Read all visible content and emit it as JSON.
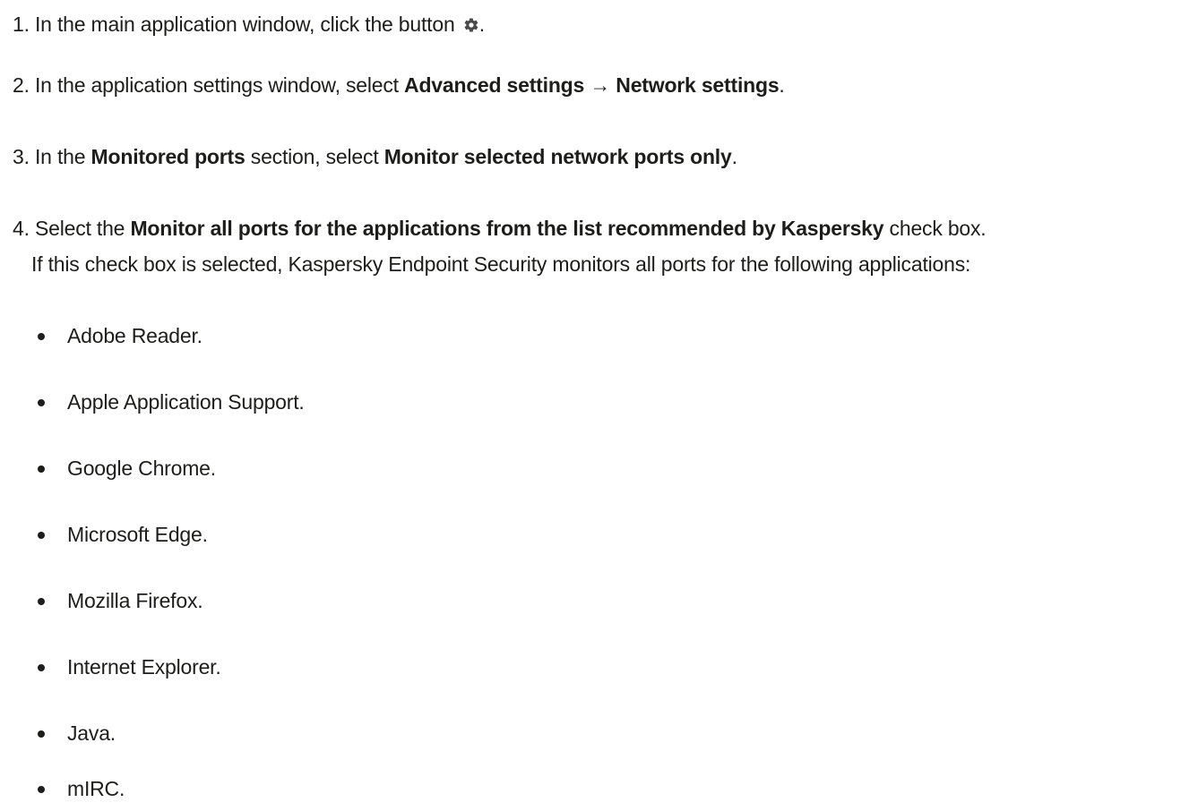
{
  "steps": [
    {
      "number": "1.",
      "parts": [
        {
          "text": " In the main application window, click the button ",
          "bold": false
        },
        {
          "icon": "gear-icon"
        },
        {
          "text": ".",
          "bold": false
        }
      ]
    },
    {
      "number": "2.",
      "parts": [
        {
          "text": " In the application settings window, select ",
          "bold": false
        },
        {
          "text": "Advanced settings → Network settings",
          "bold": true
        },
        {
          "text": ".",
          "bold": false
        }
      ]
    },
    {
      "number": "3.",
      "parts": [
        {
          "text": " In the ",
          "bold": false
        },
        {
          "text": "Monitored ports",
          "bold": true
        },
        {
          "text": " section, select ",
          "bold": false
        },
        {
          "text": "Monitor selected network ports only",
          "bold": true
        },
        {
          "text": ".",
          "bold": false
        }
      ]
    },
    {
      "number": "4.",
      "parts": [
        {
          "text": " Select the ",
          "bold": false
        },
        {
          "text": "Monitor all ports for the applications from the list recommended by Kaspersky",
          "bold": true
        },
        {
          "text": " check box.",
          "bold": false
        }
      ]
    }
  ],
  "step4_note": "If this check box is selected, Kaspersky Endpoint Security monitors all ports for the following applications:",
  "applications": [
    "Adobe Reader.",
    "Apple Application Support.",
    "Google Chrome.",
    "Microsoft Edge.",
    "Mozilla Firefox.",
    "Internet Explorer.",
    "Java.",
    "mIRC."
  ],
  "colors": {
    "text": "#1d1d1b",
    "icon": "#4a4a4a",
    "background": "#ffffff"
  }
}
